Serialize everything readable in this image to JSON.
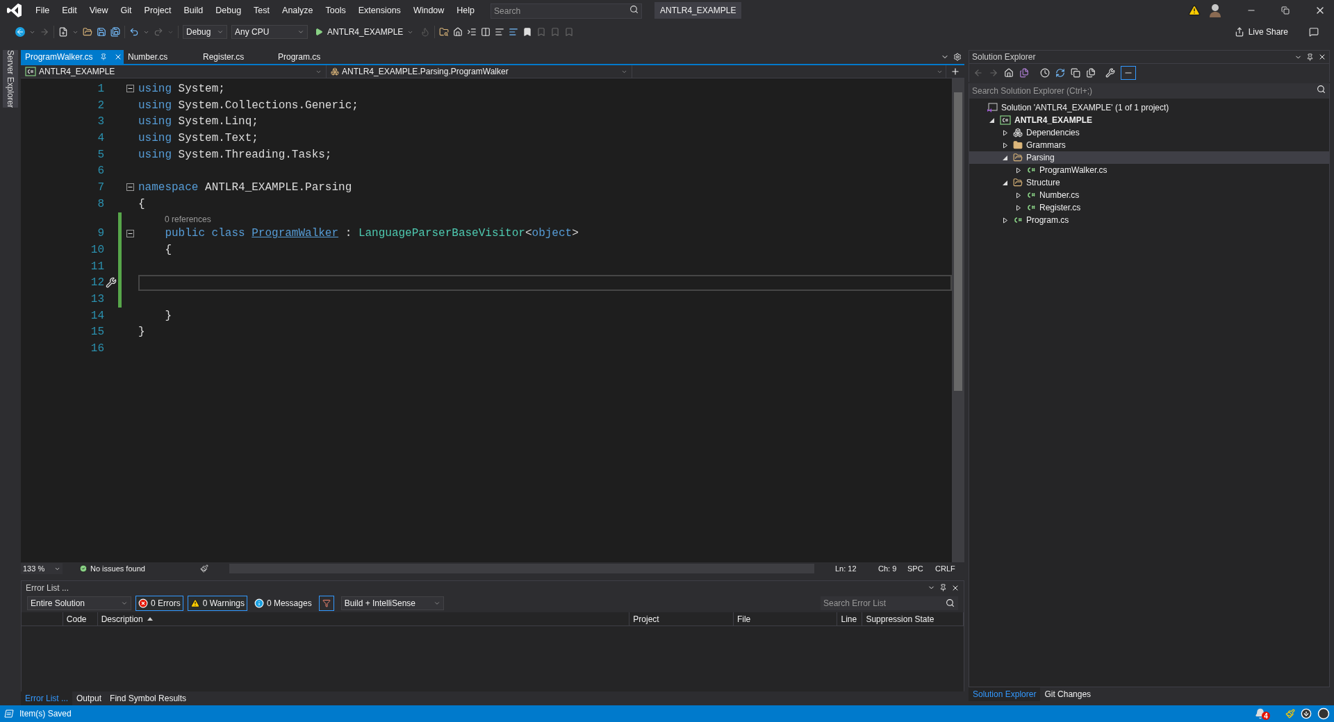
{
  "menu_bar": {
    "items": [
      "File",
      "Edit",
      "View",
      "Git",
      "Project",
      "Build",
      "Debug",
      "Test",
      "Analyze",
      "Tools",
      "Extensions",
      "Window",
      "Help"
    ],
    "search_placeholder": "Search",
    "solution_name": "ANTLR4_EXAMPLE"
  },
  "toolbar": {
    "configuration": "Debug",
    "platform": "Any CPU",
    "start_target": "ANTLR4_EXAMPLE",
    "live_share": "Live Share"
  },
  "side_strip": {
    "label": "Server Explorer"
  },
  "document_tabs": [
    {
      "label": "ProgramWalker.cs",
      "selected": true
    },
    {
      "label": "Number.cs",
      "selected": false
    },
    {
      "label": "Register.cs",
      "selected": false
    },
    {
      "label": "Program.cs",
      "selected": false
    }
  ],
  "navigation_bar": {
    "project": "ANTLR4_EXAMPLE",
    "type": "ANTLR4_EXAMPLE.Parsing.ProgramWalker"
  },
  "editor": {
    "lines": [
      {
        "number": "1",
        "fold_expanded": true,
        "tokens": [
          {
            "kind": "keyword",
            "text": "using"
          },
          {
            "kind": "plain",
            "text": " System;"
          }
        ]
      },
      {
        "number": "2",
        "tokens": [
          {
            "kind": "keyword",
            "text": "using"
          },
          {
            "kind": "plain",
            "text": " System.Collections.Generic;"
          }
        ]
      },
      {
        "number": "3",
        "tokens": [
          {
            "kind": "keyword",
            "text": "using"
          },
          {
            "kind": "plain",
            "text": " System.Linq;"
          }
        ]
      },
      {
        "number": "4",
        "tokens": [
          {
            "kind": "keyword",
            "text": "using"
          },
          {
            "kind": "plain",
            "text": " System.Text;"
          }
        ]
      },
      {
        "number": "5",
        "tokens": [
          {
            "kind": "keyword",
            "text": "using"
          },
          {
            "kind": "plain",
            "text": " System.Threading.Tasks;"
          }
        ]
      },
      {
        "number": "6"
      },
      {
        "number": "7",
        "fold_expanded": true,
        "tokens": [
          {
            "kind": "keyword",
            "text": "namespace"
          },
          {
            "kind": "plain",
            "text": " ANTLR4_EXAMPLE.Parsing"
          }
        ]
      },
      {
        "number": "8",
        "tokens": [
          {
            "kind": "plain",
            "text": "{"
          }
        ]
      },
      {
        "number": "9",
        "fold_expanded": true,
        "changed": true,
        "codelens": "0 references",
        "tokens": [
          {
            "kind": "keyword",
            "text": "    public class "
          },
          {
            "kind": "link",
            "text": "ProgramWalker"
          },
          {
            "kind": "plain",
            "text": " : "
          },
          {
            "kind": "type",
            "text": "LanguageParserBaseVisitor"
          },
          {
            "kind": "plain",
            "text": "<"
          },
          {
            "kind": "keyword",
            "text": "object"
          },
          {
            "kind": "plain",
            "text": ">"
          }
        ]
      },
      {
        "number": "10",
        "changed": true,
        "tokens": [
          {
            "kind": "plain",
            "text": "    {"
          }
        ]
      },
      {
        "number": "11",
        "changed": true
      },
      {
        "number": "12",
        "changed": true,
        "current": true,
        "quick_action": true
      },
      {
        "number": "13",
        "changed": true
      },
      {
        "number": "14",
        "tokens": [
          {
            "kind": "plain",
            "text": "    }"
          }
        ]
      },
      {
        "number": "15",
        "tokens": [
          {
            "kind": "plain",
            "text": "}"
          }
        ]
      },
      {
        "number": "16"
      }
    ]
  },
  "editor_status": {
    "zoom": "133 %",
    "issues": "No issues found",
    "line": "Ln: 12",
    "column": "Ch: 9",
    "whitespace": "SPC",
    "line_ending": "CRLF"
  },
  "error_list": {
    "title": "Error List ...",
    "scope": "Entire Solution",
    "filters": [
      {
        "kind": "error",
        "label": "0 Errors",
        "selected": true
      },
      {
        "kind": "warning",
        "label": "0 Warnings",
        "selected": true
      },
      {
        "kind": "message",
        "label": "0 Messages",
        "selected": false
      }
    ],
    "source": "Build + IntelliSense",
    "search_placeholder": "Search Error List",
    "columns": [
      "Code",
      "Description",
      "Project",
      "File",
      "Line",
      "Suppression State"
    ]
  },
  "bottom_tabs": [
    {
      "label": "Error List ...",
      "selected": true
    },
    {
      "label": "Output",
      "selected": false
    },
    {
      "label": "Find Symbol Results",
      "selected": false
    }
  ],
  "solution_explorer": {
    "title": "Solution Explorer",
    "search_placeholder": "Search Solution Explorer (Ctrl+;)",
    "tree": [
      {
        "kind": "solution",
        "label": "Solution 'ANTLR4_EXAMPLE' (1 of 1 project)",
        "selected": false,
        "children": [
          {
            "kind": "project",
            "label": "ANTLR4_EXAMPLE",
            "expanded": true,
            "selected": false,
            "children": [
              {
                "kind": "dependencies",
                "label": "Dependencies",
                "expanded": false,
                "selected": false
              },
              {
                "kind": "folder",
                "label": "Grammars",
                "expanded": false,
                "selected": false
              },
              {
                "kind": "folder",
                "label": "Parsing",
                "expanded": true,
                "selected": true,
                "children": [
                  {
                    "kind": "file",
                    "label": "ProgramWalker.cs",
                    "expanded": false,
                    "selected": false
                  }
                ]
              },
              {
                "kind": "folder",
                "label": "Structure",
                "expanded": true,
                "selected": false,
                "children": [
                  {
                    "kind": "file",
                    "label": "Number.cs",
                    "expanded": false,
                    "selected": false
                  },
                  {
                    "kind": "file",
                    "label": "Register.cs",
                    "expanded": false,
                    "selected": false
                  }
                ]
              },
              {
                "kind": "file",
                "label": "Program.cs",
                "expanded": false,
                "selected": false
              }
            ]
          }
        ]
      }
    ]
  },
  "panel_tabs": [
    {
      "label": "Solution Explorer",
      "selected": true
    },
    {
      "label": "Git Changes",
      "selected": false
    }
  ],
  "status_bar": {
    "message": "Item(s) Saved",
    "notification_count": "4"
  }
}
